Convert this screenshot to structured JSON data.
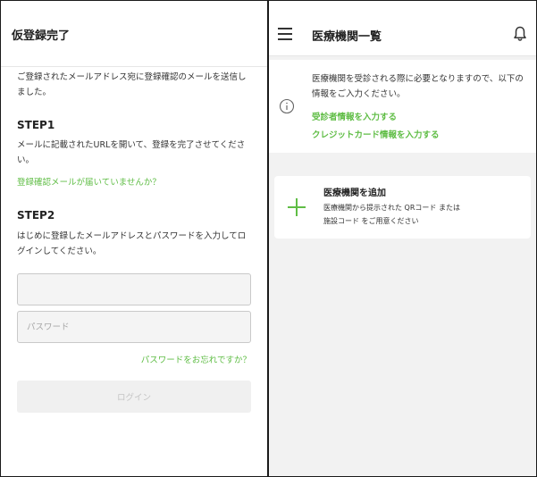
{
  "left": {
    "title": "仮登録完了",
    "intro": "ご登録されたメールアドレス宛に登録確認のメールを送信しました。",
    "step1": {
      "heading": "STEP1",
      "text": "メールに記載されたURLを開いて、登録を完了させてください。"
    },
    "resend_link": "登録確認メールが届いていませんか？",
    "step2": {
      "heading": "STEP2",
      "text": "はじめに登録したメールアドレスとパスワードを入力してログインしてください。"
    },
    "email_field": {
      "value": "",
      "placeholder": ""
    },
    "password_field": {
      "value": "",
      "placeholder": "パスワード"
    },
    "forgot_link": "パスワードをお忘れですか？",
    "login_button": "ログイン"
  },
  "right": {
    "title": "医療機関一覧",
    "info": {
      "text": "医療機関を受診される際に必要となりますので、以下の情報をご入力ください。",
      "patient_link": "受診者情報を入力する",
      "card_link": "クレジットカード情報を入力する"
    },
    "add": {
      "title": "医療機関を追加",
      "desc_line1": "医療機関から提示された QRコード または",
      "desc_line2": "施設コード をご用意ください"
    }
  },
  "colors": {
    "accent": "#5fbd45",
    "background_gray": "#f2f2f2",
    "input_bg": "#f4f4f4"
  },
  "icons": {
    "menu": "hamburger-menu-icon",
    "notification": "bell-icon",
    "info": "info-circle-icon",
    "add": "plus-icon"
  }
}
